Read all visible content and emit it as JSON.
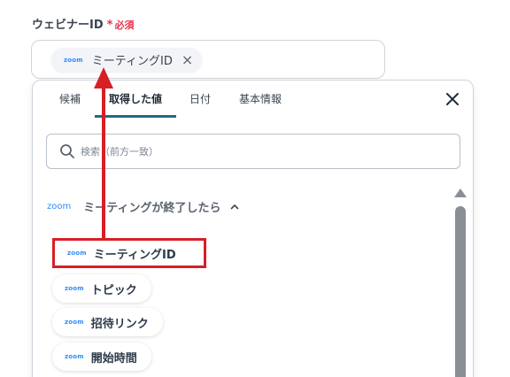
{
  "field": {
    "label": "ウェビナーID",
    "required_mark": "*",
    "required_text": "必須",
    "chip": {
      "logo": "zoom",
      "label": "ミーティングID",
      "remove": "×"
    }
  },
  "panel": {
    "tabs": [
      {
        "label": "候補"
      },
      {
        "label": "取得した値",
        "active": true
      },
      {
        "label": "日付"
      },
      {
        "label": "基本情報"
      }
    ],
    "search_placeholder": "検索（前方一致）",
    "group": {
      "logo": "zoom",
      "title": "ミーティングが終了したら"
    },
    "items": [
      {
        "logo": "zoom",
        "label": "ミーティングID",
        "highlighted": true
      },
      {
        "logo": "zoom",
        "label": "トピック"
      },
      {
        "logo": "zoom",
        "label": "招待リンク"
      },
      {
        "logo": "zoom",
        "label": "開始時間"
      }
    ]
  },
  "colors": {
    "accent": "#1f6b86",
    "highlight": "#d71f26",
    "zoom_blue": "#2d8cff",
    "required": "#e8344e"
  }
}
